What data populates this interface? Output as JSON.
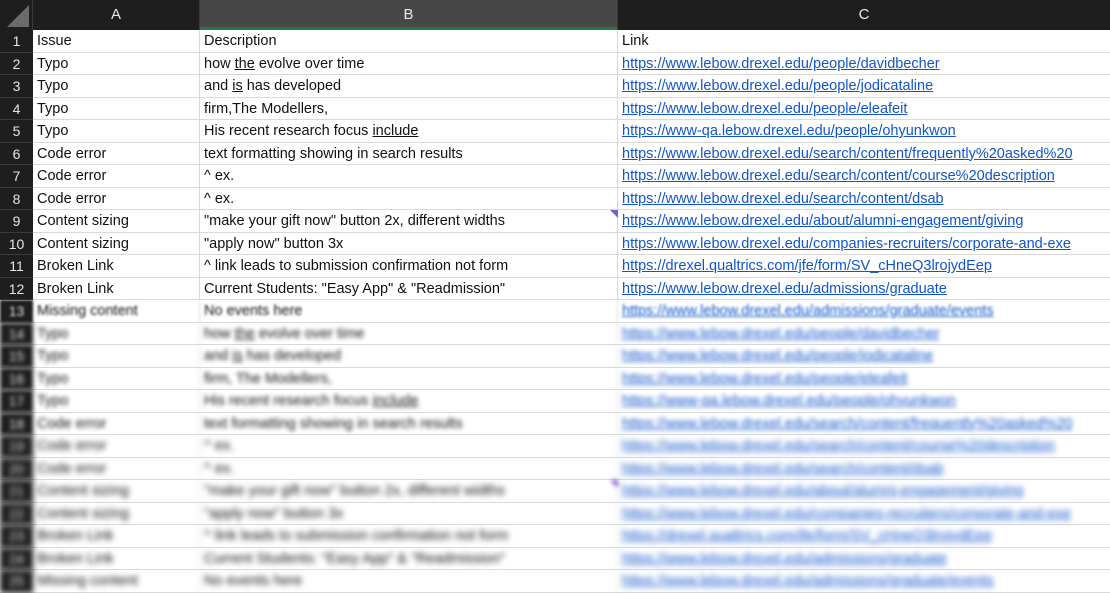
{
  "columns": [
    {
      "letter": "A",
      "label": "A"
    },
    {
      "letter": "B",
      "label": "B"
    },
    {
      "letter": "C",
      "label": "C"
    }
  ],
  "rows": [
    {
      "num": "1",
      "issue": "Issue",
      "desc_pre": "Description",
      "desc_u": "",
      "desc_post": "",
      "link": "Link"
    },
    {
      "num": "2",
      "issue": "Typo",
      "desc_pre": "how ",
      "desc_u": "the",
      "desc_post": " evolve over time",
      "link": "https://www.lebow.drexel.edu/people/davidbecher"
    },
    {
      "num": "3",
      "issue": "Typo",
      "desc_pre": "and ",
      "desc_u": "is",
      "desc_post": " has developed",
      "link": "https://www.lebow.drexel.edu/people/jodicataline"
    },
    {
      "num": "4",
      "issue": "Typo",
      "desc_pre": "firm,The Modellers,",
      "desc_u": "",
      "desc_post": "",
      "link": "https://www.lebow.drexel.edu/people/eleafeit"
    },
    {
      "num": "5",
      "issue": "Typo",
      "desc_pre": "His recent research focus ",
      "desc_u": "include",
      "desc_post": "",
      "link": "https://www-qa.lebow.drexel.edu/people/ohyunkwon"
    },
    {
      "num": "6",
      "issue": "Code error",
      "desc_pre": "text formatting showing in search results",
      "desc_u": "",
      "desc_post": "",
      "link": "https://www.lebow.drexel.edu/search/content/frequently%20asked%20"
    },
    {
      "num": "7",
      "issue": "Code error",
      "desc_pre": "^ ex.",
      "desc_u": "",
      "desc_post": "",
      "link": "https://www.lebow.drexel.edu/search/content/course%20description"
    },
    {
      "num": "8",
      "issue": "Code error",
      "desc_pre": "^ ex.",
      "desc_u": "",
      "desc_post": "",
      "link": "https://www.lebow.drexel.edu/search/content/dsab"
    },
    {
      "num": "9",
      "issue": "Content sizing",
      "desc_pre": "\"make your gift now\" button 2x, different widths",
      "desc_u": "",
      "desc_post": "",
      "link": "https://www.lebow.drexel.edu/about/alumni-engagement/giving"
    },
    {
      "num": "10",
      "issue": "Content sizing",
      "desc_pre": "\"apply now\" button 3x",
      "desc_u": "",
      "desc_post": "",
      "link": "https://www.lebow.drexel.edu/companies-recruiters/corporate-and-exe"
    },
    {
      "num": "11",
      "issue": "Broken Link",
      "desc_pre": "^ link leads to submission confirmation not form",
      "desc_u": "",
      "desc_post": "",
      "link": "https://drexel.qualtrics.com/jfe/form/SV_cHneQ3lrojydEep"
    },
    {
      "num": "12",
      "issue": "Broken Link",
      "desc_pre": "Current Students: \"Easy App\" & \"Readmission\"",
      "desc_u": "",
      "desc_post": "",
      "link": "https://www.lebow.drexel.edu/admissions/graduate"
    },
    {
      "num": "13",
      "issue": "Missing content",
      "desc_pre": "No events here",
      "desc_u": "",
      "desc_post": "",
      "link": "https://www.lebow.drexel.edu/admissions/graduate/events"
    },
    {
      "num": "14",
      "issue": "Typo",
      "desc_pre": "how ",
      "desc_u": "the",
      "desc_post": " evolve over time",
      "link": "https://www.lebow.drexel.edu/people/davidbecher"
    },
    {
      "num": "15",
      "issue": "Typo",
      "desc_pre": "and ",
      "desc_u": "is",
      "desc_post": " has developed",
      "link": "https://www.lebow.drexel.edu/people/jodicataline"
    },
    {
      "num": "16",
      "issue": "Typo",
      "desc_pre": "firm, The Modellers,",
      "desc_u": "",
      "desc_post": "",
      "link": "https://www.lebow.drexel.edu/people/eleafeit"
    },
    {
      "num": "17",
      "issue": "Typo",
      "desc_pre": "His recent research focus ",
      "desc_u": "include",
      "desc_post": "",
      "link": "https://www-qa.lebow.drexel.edu/people/ohyunkwon"
    },
    {
      "num": "18",
      "issue": "Code error",
      "desc_pre": "text formatting showing in search results",
      "desc_u": "",
      "desc_post": "",
      "link": "https://www.lebow.drexel.edu/search/content/frequently%20asked%20"
    },
    {
      "num": "19",
      "issue": "Code error",
      "desc_pre": "^ ex.",
      "desc_u": "",
      "desc_post": "",
      "link": "https://www.lebow.drexel.edu/search/content/course%20description"
    },
    {
      "num": "20",
      "issue": "Code error",
      "desc_pre": "^ ex.",
      "desc_u": "",
      "desc_post": "",
      "link": "https://www.lebow.drexel.edu/search/content/dsab"
    },
    {
      "num": "21",
      "issue": "Content sizing",
      "desc_pre": "\"make your gift now\" button 2x, different widths",
      "desc_u": "",
      "desc_post": "",
      "link": "https://www.lebow.drexel.edu/about/alumni-engagement/giving"
    },
    {
      "num": "22",
      "issue": "Content sizing",
      "desc_pre": "\"apply now\" button 3x",
      "desc_u": "",
      "desc_post": "",
      "link": "https://www.lebow.drexel.edu/companies-recruiters/corporate-and-exe"
    },
    {
      "num": "23",
      "issue": "Broken Link",
      "desc_pre": "^ link leads to submission confirmation not form",
      "desc_u": "",
      "desc_post": "",
      "link": "https://drexel.qualtrics.com/jfe/form/SV_cHneQ3lrojydEep"
    },
    {
      "num": "24",
      "issue": "Broken Link",
      "desc_pre": "Current Students: \"Easy App\" & \"Readmission\"",
      "desc_u": "",
      "desc_post": "",
      "link": "https://www.lebow.drexel.edu/admissions/graduate"
    },
    {
      "num": "25",
      "issue": "Missing content",
      "desc_pre": "No events here",
      "desc_u": "",
      "desc_post": "",
      "link": "https://www.lebow.drexel.edu/admissions/graduate/events"
    }
  ],
  "colors": {
    "header_bg": "#1e1e1e",
    "selected_col": "#474747",
    "selected_underline": "#1f7a43",
    "link": "#1155cc",
    "comment_flag": "#7b5cd6"
  }
}
